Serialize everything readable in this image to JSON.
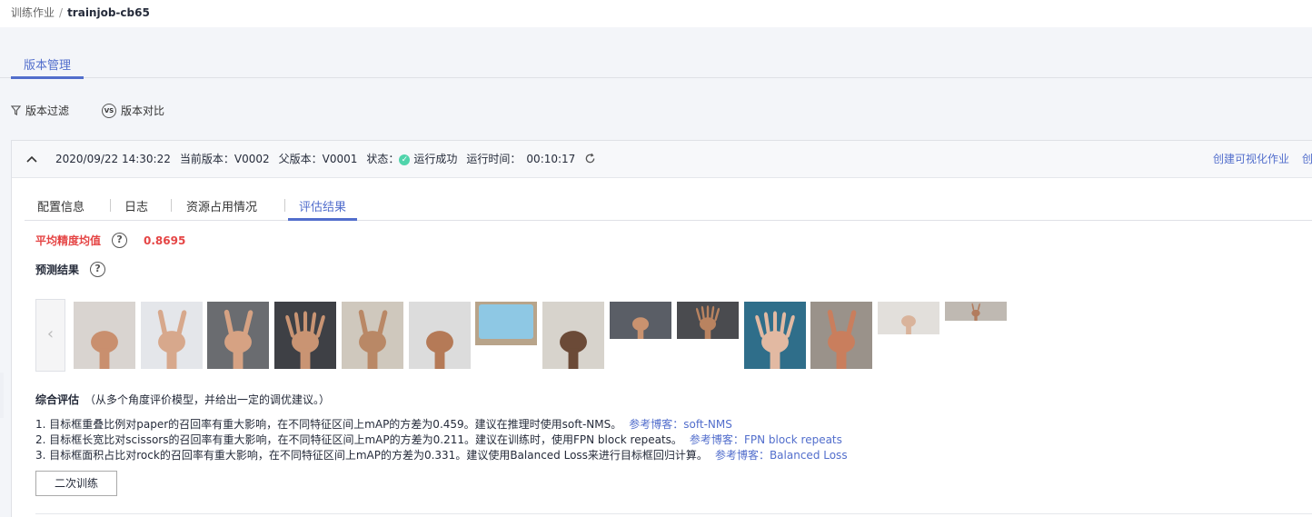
{
  "breadcrumb": {
    "parent": "训练作业",
    "separator": "/",
    "current": "trainjob-cb65"
  },
  "tabs": {
    "version_management": "版本管理"
  },
  "toolbar": {
    "filter": "版本过滤",
    "compare": "版本对比",
    "compare_icon_text": "VS"
  },
  "version_header": {
    "datetime": "2020/09/22 14:30:22",
    "current_version": "当前版本：V0002",
    "parent_version": "父版本：V0001",
    "status_label": "状态：",
    "status_value": "运行成功",
    "runtime_label": "运行时间：",
    "runtime_value": "00:10:17",
    "action_create_vis": "创建可视化作业",
    "action_create_more": "创"
  },
  "subtabs": [
    "配置信息",
    "日志",
    "资源占用情况",
    "评估结果"
  ],
  "evaluation": {
    "map_label": "平均精度均值",
    "map_value": "0.8695",
    "prediction_label": "预测结果",
    "help_glyph": "?",
    "prev_glyph": "‹"
  },
  "thumbnails": [
    {
      "icon": "hand-fist-image",
      "bg": "#d9d4d0",
      "skin": "#c98f6e"
    },
    {
      "icon": "hand-scissors-image",
      "bg": "#e4e6ea",
      "skin": "#d7a88c"
    },
    {
      "icon": "hand-scissors-image",
      "bg": "#6a6c70",
      "skin": "#d6a283"
    },
    {
      "icon": "hand-paper-image",
      "bg": "#3e4045",
      "skin": "#c99473"
    },
    {
      "icon": "hand-scissors-image",
      "bg": "#cfc8bd",
      "skin": "#b98866"
    },
    {
      "icon": "hand-rock-image",
      "bg": "#dcdcdc",
      "skin": "#b57a57"
    },
    {
      "icon": "towel-image",
      "bg": "#b8a48a",
      "skin": "#8ec8e4"
    },
    {
      "icon": "hand-rock-image",
      "bg": "#d7d3cc",
      "skin": "#6b4a37"
    },
    {
      "icon": "hand-fist-image",
      "bg": "#5a5e66",
      "skin": "#c9926f"
    },
    {
      "icon": "hand-paper-image",
      "bg": "#4a4b4f",
      "skin": "#b98360"
    },
    {
      "icon": "hand-paper-image",
      "bg": "#2f6e8a",
      "skin": "#e2b9a2"
    },
    {
      "icon": "hand-scissors-image",
      "bg": "#9a928a",
      "skin": "#c97e5d"
    },
    {
      "icon": "hand-rock-image",
      "bg": "#e2dfdb",
      "skin": "#d9b39b"
    },
    {
      "icon": "hand-scissors-image",
      "bg": "#bfb9b2",
      "skin": "#b27c5e"
    }
  ],
  "summary": {
    "title": "综合评估",
    "subtitle": "（从多个角度评价模型，并给出一定的调优建议。）"
  },
  "findings": [
    {
      "text": "1. 目标框重叠比例对paper的召回率有重大影响，在不同特征区间上mAP的方差为0.459。建议在推理时使用soft-NMS。",
      "ref_label": "参考博客：",
      "ref_link": "soft-NMS"
    },
    {
      "text": "2. 目标框长宽比对scissors的召回率有重大影响，在不同特征区间上mAP的方差为0.211。建议在训练时，使用FPN block repeats。",
      "ref_label": "参考博客：",
      "ref_link": "FPN block repeats"
    },
    {
      "text": "3. 目标框面积占比对rock的召回率有重大影响，在不同特征区间上mAP的方差为0.331。建议使用Balanced Loss来进行目标框回归计算。",
      "ref_label": "参考博客：",
      "ref_link": "Balanced Loss"
    }
  ],
  "retrain_button": "二次训练"
}
